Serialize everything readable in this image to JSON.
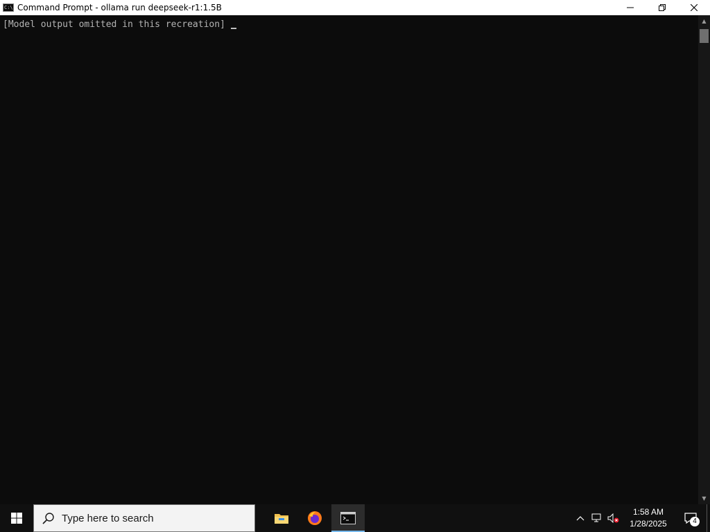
{
  "window": {
    "title": "Command Prompt - ollama  run deepseek-r1:1.5B",
    "app_icon_text": "C:\\",
    "minimize_icon": "minimize-icon",
    "maximize_icon": "maximize-icon",
    "close_icon": "close-icon"
  },
  "console": {
    "placeholder": "[Model output omitted in this recreation]"
  },
  "taskbar": {
    "search_placeholder": "Type here to search",
    "apps": [
      {
        "name": "file-explorer",
        "icon": "folder-icon"
      },
      {
        "name": "firefox",
        "icon": "firefox-icon"
      },
      {
        "name": "command-prompt",
        "icon": "terminal-icon",
        "active": true
      }
    ],
    "time": "1:58 AM",
    "date": "1/28/2025",
    "notification_count": "4",
    "accent_color": "#76b9ed"
  }
}
